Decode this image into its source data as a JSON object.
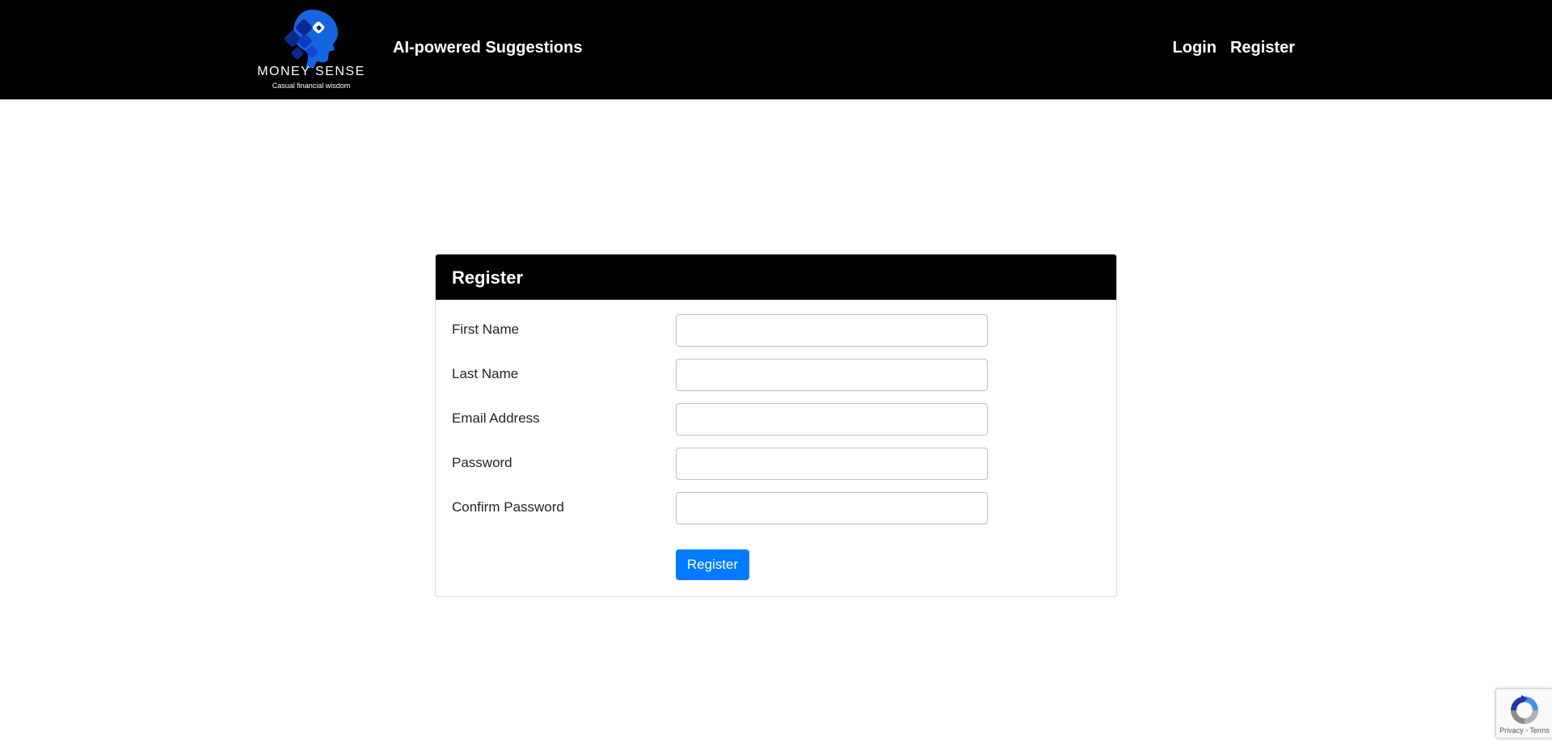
{
  "navbar": {
    "brand_name": "MONEY SENSE",
    "brand_tagline": "Casual financial wisdom",
    "title": "AI-powered Suggestions",
    "links": [
      {
        "label": "Login"
      },
      {
        "label": "Register"
      }
    ]
  },
  "card": {
    "title": "Register",
    "fields": [
      {
        "label": "First Name",
        "value": "",
        "placeholder": ""
      },
      {
        "label": "Last Name",
        "value": "",
        "placeholder": ""
      },
      {
        "label": "Email Address",
        "value": "",
        "placeholder": ""
      },
      {
        "label": "Password",
        "value": "",
        "placeholder": ""
      },
      {
        "label": "Confirm Password",
        "value": "",
        "placeholder": ""
      }
    ],
    "submit_label": "Register"
  },
  "recaptcha": {
    "privacy_label": "Privacy",
    "separator": " - ",
    "terms_label": "Terms"
  },
  "colors": {
    "navbar_bg": "#000000",
    "card_header_bg": "#000000",
    "primary_button": "#007bff",
    "logo_dark_blue": "#0a2a8f",
    "logo_blue": "#1565e0"
  },
  "icons": {
    "brand": "money-sense-logo-icon",
    "recaptcha": "recaptcha-icon"
  }
}
